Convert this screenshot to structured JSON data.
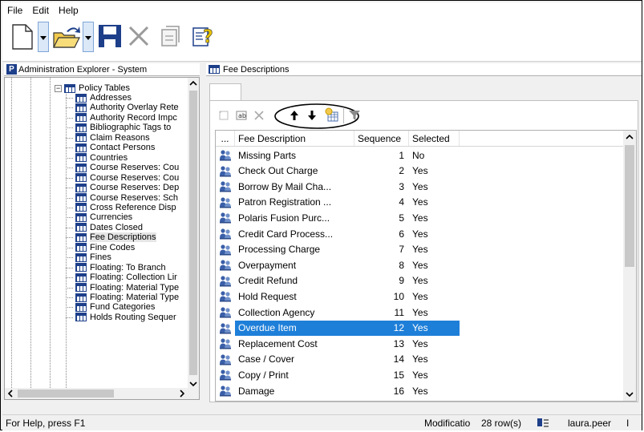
{
  "menu": {
    "file": "File",
    "edit": "Edit",
    "help": "Help"
  },
  "left_panel": {
    "title": "Administration Explorer - System",
    "root": "Policy Tables",
    "items": [
      "Addresses",
      "Authority Overlay Rete",
      "Authority Record Impc",
      "Bibliographic Tags to",
      "Claim Reasons",
      "Contact Persons",
      "Countries",
      "Course Reserves: Cou",
      "Course Reserves: Cou",
      "Course Reserves: Dep",
      "Course Reserves: Sch",
      "Cross Reference Disp",
      "Currencies",
      "Dates Closed",
      "Fee Descriptions",
      "Fine Codes",
      "Fines",
      "Floating: To Branch",
      "Floating: Collection Lir",
      "Floating: Material Type",
      "Floating: Material Type",
      "Fund Categories",
      "Holds Routing Sequer"
    ]
  },
  "right_panel": {
    "title": "Fee Descriptions",
    "columns": {
      "dots": "...",
      "desc": "Fee Description",
      "seq": "Sequence",
      "selected": "Selected"
    },
    "rows": [
      {
        "desc": "Missing Parts",
        "seq": "1",
        "sel": "No"
      },
      {
        "desc": "Check Out Charge",
        "seq": "2",
        "sel": "Yes"
      },
      {
        "desc": "Borrow By Mail Cha...",
        "seq": "3",
        "sel": "Yes"
      },
      {
        "desc": "Patron Registration ...",
        "seq": "4",
        "sel": "Yes"
      },
      {
        "desc": "Polaris Fusion Purc...",
        "seq": "5",
        "sel": "Yes"
      },
      {
        "desc": "Credit Card Process...",
        "seq": "6",
        "sel": "Yes"
      },
      {
        "desc": "Processing Charge",
        "seq": "7",
        "sel": "Yes"
      },
      {
        "desc": "Overpayment",
        "seq": "8",
        "sel": "Yes"
      },
      {
        "desc": "Credit Refund",
        "seq": "9",
        "sel": "Yes"
      },
      {
        "desc": "Hold Request",
        "seq": "10",
        "sel": "Yes"
      },
      {
        "desc": "Collection Agency",
        "seq": "11",
        "sel": "Yes"
      },
      {
        "desc": "Overdue Item",
        "seq": "12",
        "sel": "Yes"
      },
      {
        "desc": "Replacement Cost",
        "seq": "13",
        "sel": "Yes"
      },
      {
        "desc": "Case / Cover",
        "seq": "14",
        "sel": "Yes"
      },
      {
        "desc": "Copy / Print",
        "seq": "15",
        "sel": "Yes"
      },
      {
        "desc": "Damage",
        "seq": "16",
        "sel": "Yes"
      }
    ],
    "selected_row": 12
  },
  "status": {
    "help": "For Help, press F1",
    "modification": "Modificatio",
    "rows": "28 row(s)",
    "user": "laura.peer",
    "extra": "I"
  },
  "colors": {
    "selection": "#1e7fd9",
    "icon_blue": "#1d3f8a",
    "folder_yellow": "#f2c94c"
  }
}
